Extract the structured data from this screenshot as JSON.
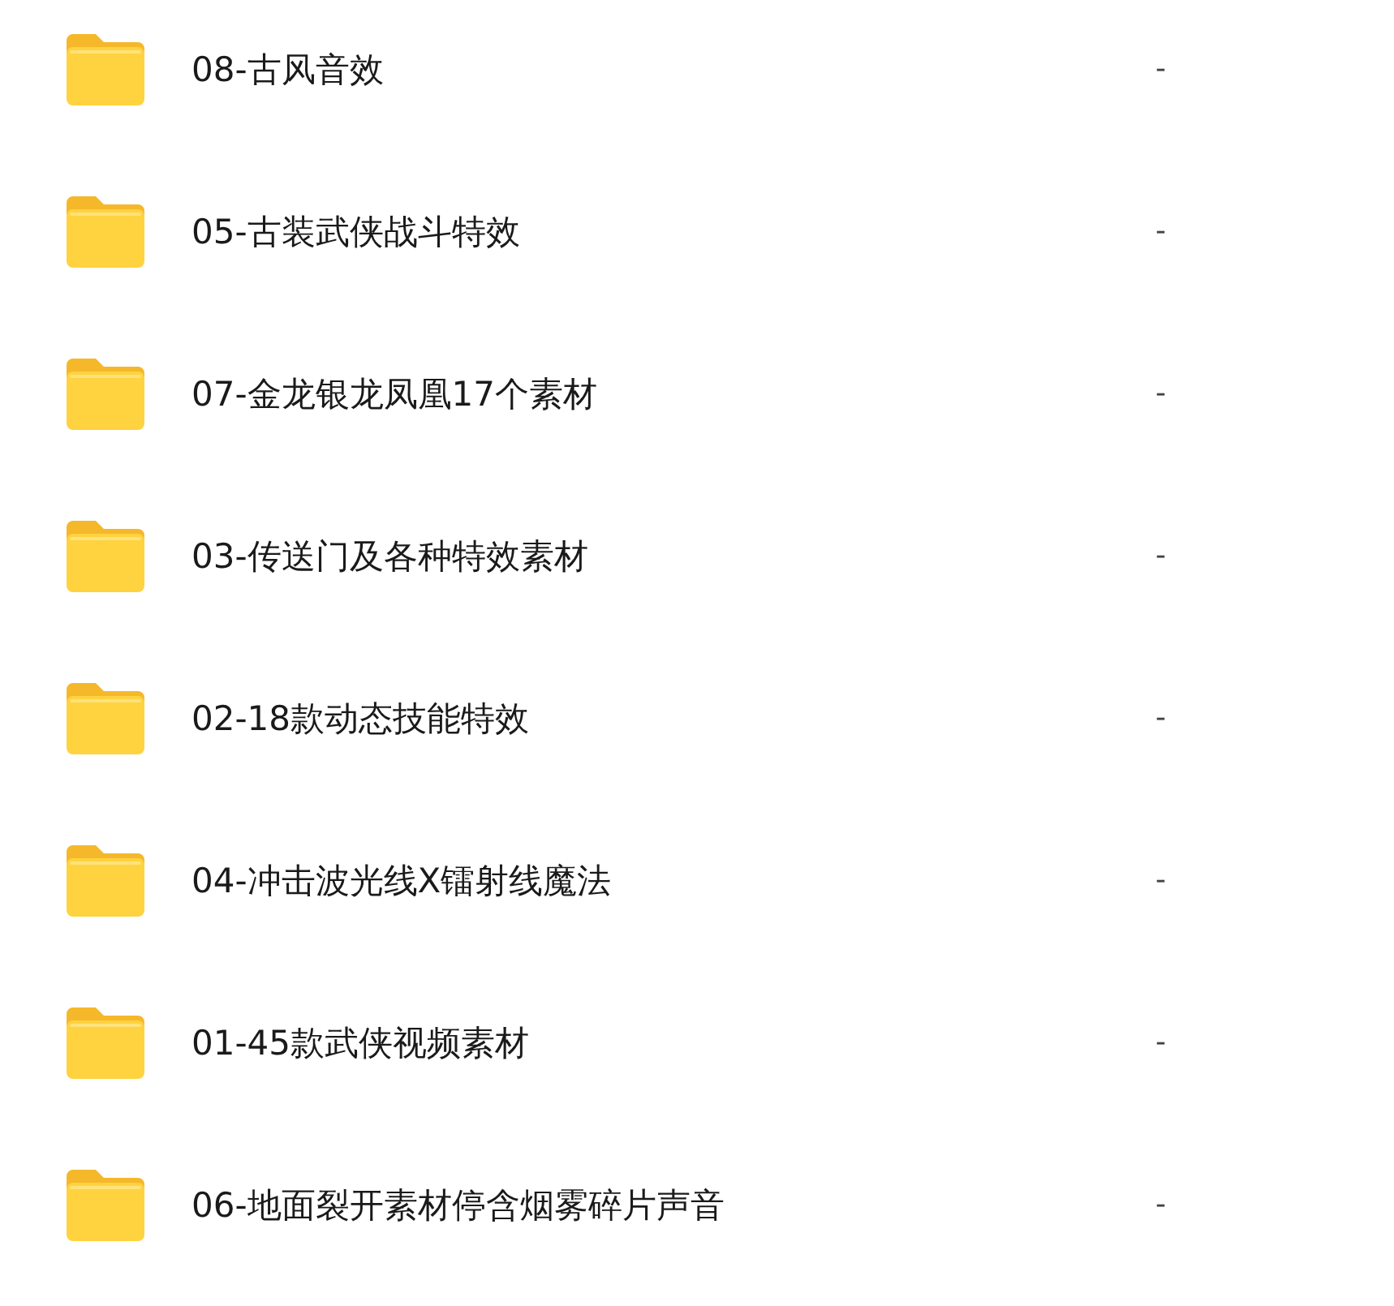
{
  "files": [
    {
      "name": "08-古风音效",
      "size": "-"
    },
    {
      "name": "05-古装武侠战斗特效",
      "size": "-"
    },
    {
      "name": "07-金龙银龙凤凰17个素材",
      "size": "-"
    },
    {
      "name": "03-传送门及各种特效素材",
      "size": "-"
    },
    {
      "name": "02-18款动态技能特效",
      "size": "-"
    },
    {
      "name": "04-冲击波光线X镭射线魔法",
      "size": "-"
    },
    {
      "name": "01-45款武侠视频素材",
      "size": "-"
    },
    {
      "name": "06-地面裂开素材停含烟雾碎片声音",
      "size": "-"
    }
  ]
}
